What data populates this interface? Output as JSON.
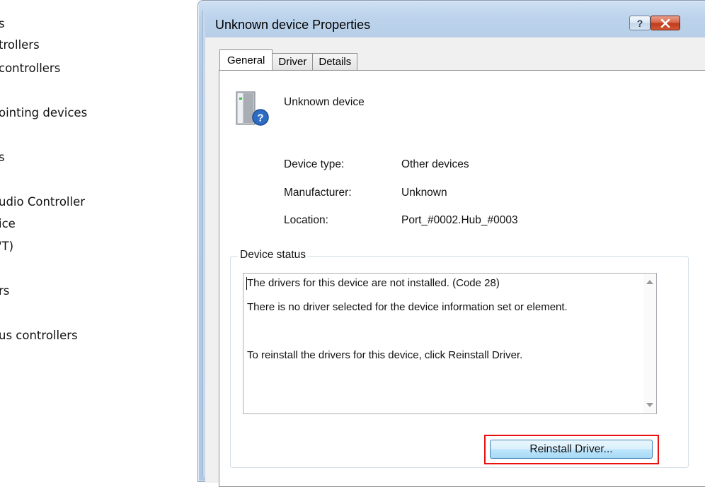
{
  "background_list": {
    "items": [
      "s",
      "trollers",
      "controllers",
      "ointing devices",
      "s",
      "udio Controller",
      "ice",
      "'T)",
      "rs",
      "us controllers"
    ]
  },
  "dialog": {
    "title": "Unknown device Properties",
    "help_label": "?",
    "tabs": [
      "General",
      "Driver",
      "Details"
    ],
    "active_tab": "General",
    "device_name": "Unknown device",
    "properties": [
      {
        "label": "Device type:",
        "value": "Other devices"
      },
      {
        "label": "Manufacturer:",
        "value": "Unknown"
      },
      {
        "label": "Location:",
        "value": "Port_#0002.Hub_#0003"
      }
    ],
    "status_group_label": "Device status",
    "status_lines": [
      "The drivers for this device are not installed. (Code 28)",
      "There is no driver selected for the device information set or element.",
      "To reinstall the drivers for this device, click Reinstall Driver."
    ],
    "reinstall_button": "Reinstall Driver..."
  },
  "colors": {
    "highlight": "#e81010",
    "title_bar": "#bcd3ec",
    "close_button": "#c03a1c"
  },
  "icons": [
    "unknown-device-icon",
    "help-icon",
    "close-icon",
    "scroll-up-arrow-icon",
    "scroll-down-arrow-icon"
  ]
}
